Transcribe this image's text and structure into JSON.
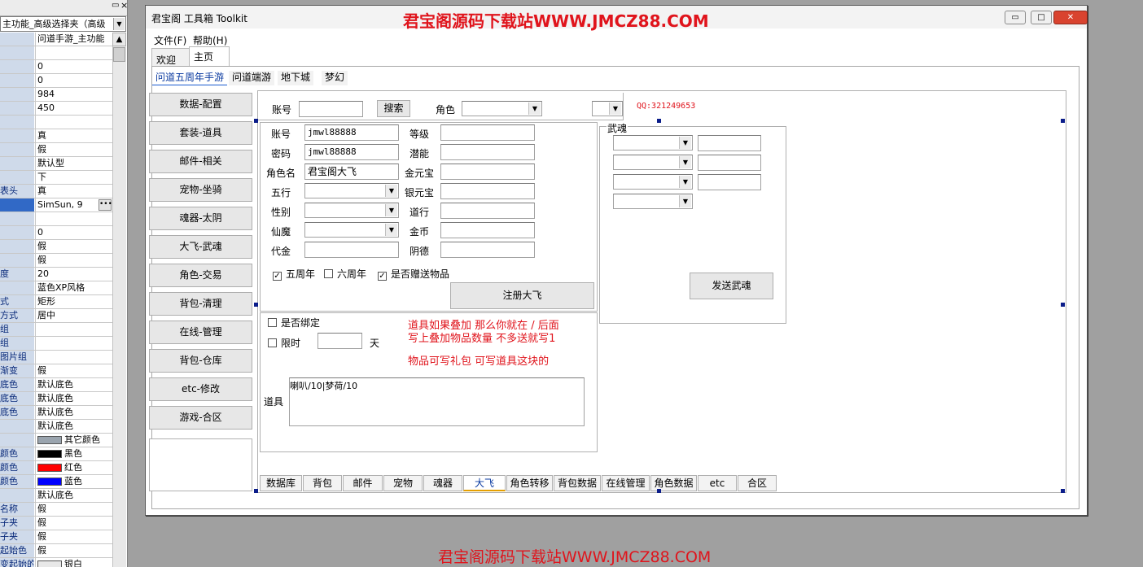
{
  "property_panel": {
    "selector": "主功能_高级选择夹（高级",
    "rows": [
      {
        "key": "",
        "value": "问道手游_主功能"
      },
      {
        "key": "",
        "value": ""
      },
      {
        "key": "",
        "value": "0"
      },
      {
        "key": "",
        "value": "0"
      },
      {
        "key": "",
        "value": "984"
      },
      {
        "key": "",
        "value": "450"
      },
      {
        "key": "",
        "value": ""
      },
      {
        "key": "",
        "value": "真"
      },
      {
        "key": "",
        "value": "假"
      },
      {
        "key": "",
        "value": "默认型"
      },
      {
        "key": "",
        "value": "下"
      },
      {
        "key": "表头",
        "value": "真"
      },
      {
        "key": "",
        "value": "SimSun, 9"
      },
      {
        "key": "",
        "value": ""
      },
      {
        "key": "",
        "value": "0"
      },
      {
        "key": "",
        "value": "假"
      },
      {
        "key": "",
        "value": "假"
      },
      {
        "key": "度",
        "value": "20"
      },
      {
        "key": "",
        "value": "蓝色XP风格"
      },
      {
        "key": "式",
        "value": "矩形"
      },
      {
        "key": "方式",
        "value": "居中"
      },
      {
        "key": "组",
        "value": ""
      },
      {
        "key": "组",
        "value": ""
      },
      {
        "key": "图片组",
        "value": ""
      },
      {
        "key": "渐变",
        "value": "假"
      },
      {
        "key": "底色",
        "value": "默认底色"
      },
      {
        "key": "底色",
        "value": "默认底色"
      },
      {
        "key": "底色",
        "value": "默认底色"
      },
      {
        "key": "",
        "value": "默认底色"
      },
      {
        "key": "",
        "value": "其它颜色"
      },
      {
        "key": "颜色",
        "value": "黑色"
      },
      {
        "key": "颜色",
        "value": "红色"
      },
      {
        "key": "颜色",
        "value": "蓝色"
      },
      {
        "key": "",
        "value": "默认底色"
      },
      {
        "key": "名称",
        "value": "假"
      },
      {
        "key": "子夹",
        "value": "假"
      },
      {
        "key": "子夹",
        "value": "假"
      },
      {
        "key": "起始色",
        "value": "假"
      },
      {
        "key": "变起始的",
        "value": "银白"
      }
    ],
    "swatch_colors": {
      "其它颜色": "#9aa4ae",
      "黑色": "#000000",
      "红色": "#ff0000",
      "蓝色": "#0000ff",
      "银白": "#e8e8e8"
    }
  },
  "window": {
    "title": "君宝阁 工具箱 Toolkit",
    "watermark": "君宝阁源码下载站WWW.JMCZ88.COM",
    "min_btn": "▭",
    "max_btn": "□",
    "close_btn": "✕"
  },
  "menu": {
    "file": "文件(F)",
    "help": "帮助(H)"
  },
  "top_tabs": [
    "欢迎",
    "主页"
  ],
  "sub_tabs": [
    "问道五周年手游",
    "问道端游",
    "地下城",
    "梦幻"
  ],
  "nav_buttons": [
    "数据-配置",
    "套装-道具",
    "邮件-相关",
    "宠物-坐骑",
    "魂器-太阴",
    "大飞-武魂",
    "角色-交易",
    "背包-清理",
    "在线-管理",
    "背包-仓库",
    "etc-修改",
    "游戏-合区"
  ],
  "search_bar": {
    "account_label": "账号",
    "account_value": "",
    "search_button": "搜索",
    "role_label": "角色",
    "role_value": "",
    "extra_value": "",
    "qq": "QQ:321249653"
  },
  "form": {
    "account_label": "账号",
    "account_value": "jmwl88888",
    "password_label": "密码",
    "password_value": "jmwl88888",
    "rolename_label": "角色名",
    "rolename_value": "君宝阁大飞",
    "wuxing_label": "五行",
    "gender_label": "性别",
    "xianmo_label": "仙魔",
    "daijin_label": "代金",
    "level_label": "等级",
    "potential_label": "潜能",
    "gold_yuanbao_label": "金元宝",
    "silver_yuanbao_label": "银元宝",
    "daohang_label": "道行",
    "coin_label": "金币",
    "yinde_label": "阴德",
    "chk_5th": "五周年",
    "chk_6th": "六周年",
    "chk_gift": "是否赠送物品",
    "register_button": "注册大飞"
  },
  "wuhun": {
    "title": "武魂",
    "send_button": "发送武魂"
  },
  "items": {
    "bind_label": "是否绑定",
    "timed_label": "限时",
    "days_label": "天",
    "days_value": "",
    "items_label": "道具",
    "items_value": "喇叭/10|梦荷/10",
    "note_line1": "道具如果叠加 那么你就在 / 后面",
    "note_line2": "写上叠加物品数量 不多送就写1",
    "note_line3": "物品可写礼包 可写道具这块的"
  },
  "bottom_tabs": [
    "数据库",
    "背包",
    "邮件",
    "宠物",
    "魂器",
    "大飞",
    "角色转移",
    "背包数据",
    "在线管理",
    "角色数据",
    "etc",
    "合区"
  ],
  "active_bottom_tab": "大飞",
  "footer_watermark": "君宝阁源码下载站WWW.JMCZ88.COM"
}
